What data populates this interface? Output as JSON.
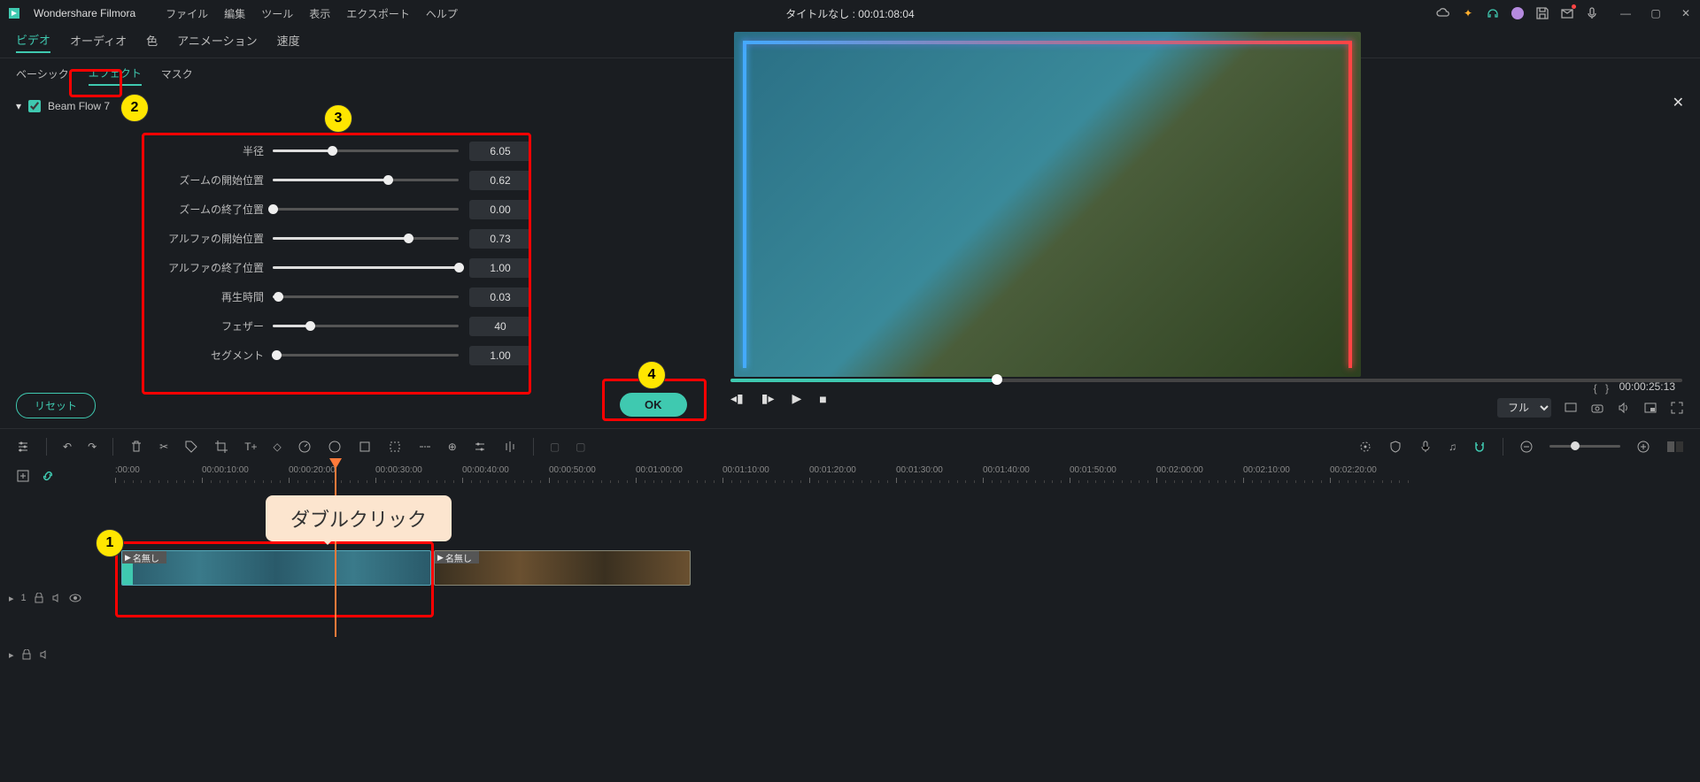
{
  "app": {
    "name": "Wondershare Filmora",
    "title_center": "タイトルなし : 00:01:08:04"
  },
  "menu": {
    "file": "ファイル",
    "edit": "編集",
    "tool": "ツール",
    "view": "表示",
    "export": "エクスポート",
    "help": "ヘルプ"
  },
  "tabs": {
    "video": "ビデオ",
    "audio": "オーディオ",
    "color": "色",
    "animation": "アニメーション",
    "speed": "速度"
  },
  "subtabs": {
    "basic": "ベーシック",
    "effect": "エフェクト",
    "mask": "マスク"
  },
  "effect": {
    "name": "Beam Flow 7",
    "close": "✕",
    "params": [
      {
        "label": "半径",
        "value": "6.05",
        "pct": 32
      },
      {
        "label": "ズームの開始位置",
        "value": "0.62",
        "pct": 62
      },
      {
        "label": "ズームの終了位置",
        "value": "0.00",
        "pct": 0
      },
      {
        "label": "アルファの開始位置",
        "value": "0.73",
        "pct": 73
      },
      {
        "label": "アルファの終了位置",
        "value": "1.00",
        "pct": 100
      },
      {
        "label": "再生時間",
        "value": "0.03",
        "pct": 3
      },
      {
        "label": "フェザー",
        "value": "40",
        "pct": 20
      },
      {
        "label": "セグメント",
        "value": "1.00",
        "pct": 2
      }
    ]
  },
  "buttons": {
    "reset": "リセット",
    "ok": "OK"
  },
  "preview": {
    "timecode": "00:00:25:13",
    "markers": "{    }",
    "quality_label": "フル"
  },
  "timeline": {
    "labels": [
      ":00:00",
      "00:00:10:00",
      "00:00:20:00",
      "00:00:30:00",
      "00:00:40:00",
      "00:00:50:00",
      "00:01:00:00",
      "00:01:10:00",
      "00:01:20:00",
      "00:01:30:00",
      "00:01:40:00",
      "00:01:50:00",
      "00:02:00:00",
      "00:02:10:00",
      "00:02:20:00"
    ],
    "clip1_label": "名無し",
    "clip2_label": "名無し",
    "track_label": "1"
  },
  "annotations": {
    "b1": "1",
    "b2": "2",
    "b3": "3",
    "b4": "4",
    "bubble": "ダブルクリック"
  }
}
